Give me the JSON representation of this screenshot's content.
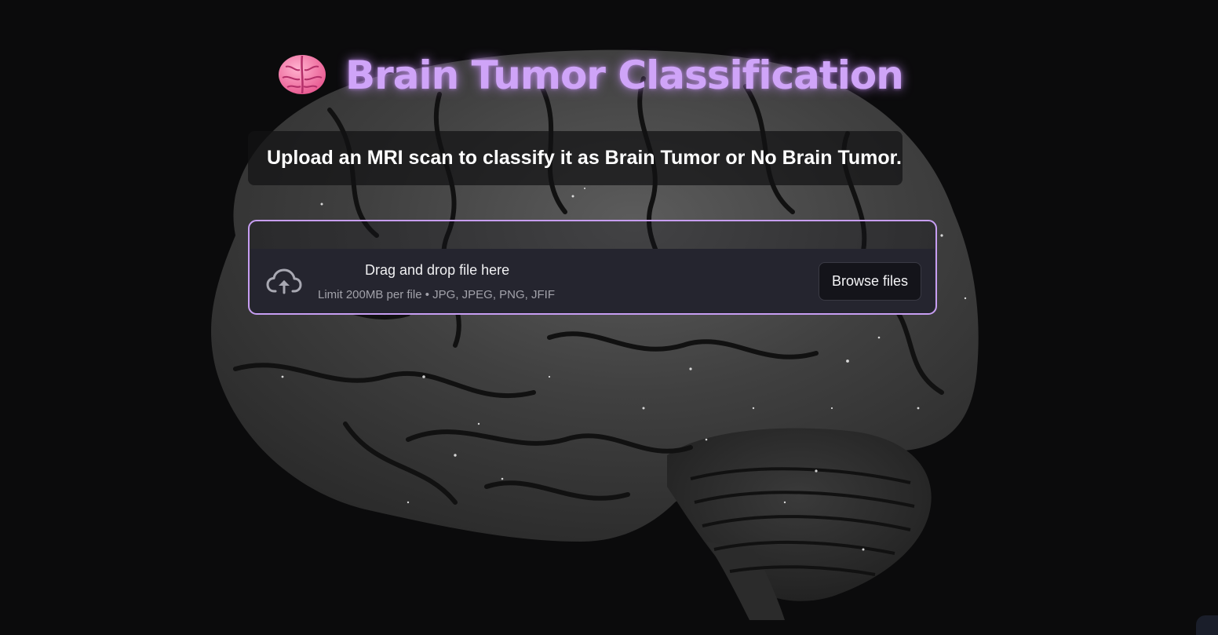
{
  "title": {
    "emoji_icon": "brain-icon",
    "text": "Brain Tumor Classification"
  },
  "subtitle": "Upload an MRI scan to classify it as Brain Tumor or No Brain Tumor.",
  "uploader": {
    "icon": "cloud-upload-icon",
    "drag_text": "Drag and drop file here",
    "limit_text": "Limit 200MB per file • JPG, JPEG, PNG, JFIF",
    "browse_label": "Browse files"
  },
  "colors": {
    "accent": "#cfa4f8",
    "uploader_border": "#c79ef3",
    "dropzone_bg": "#25252f",
    "page_bg": "#0b0b0c"
  }
}
